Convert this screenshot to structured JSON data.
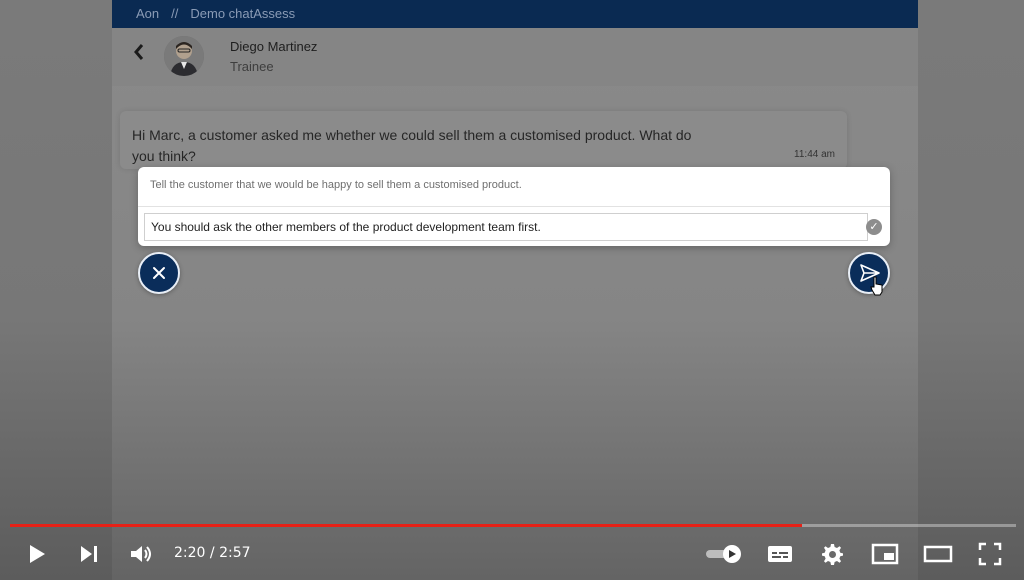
{
  "app": {
    "breadcrumb": {
      "org": "Aon",
      "separator": "//",
      "page": "Demo chatAssess"
    },
    "colors": {
      "brand": "#0a2a52",
      "accent": "#0a2d5a"
    }
  },
  "header": {
    "name": "Diego Martinez",
    "role": "Trainee"
  },
  "chat": {
    "message": "Hi Marc, a customer asked me whether we could sell them a customised product. What do you think?",
    "time": "11:44 am"
  },
  "responses": {
    "option_1": "Tell the customer that we would be happy to sell them a customised product.",
    "option_2": "You should ask the other members of the product development team first."
  },
  "player": {
    "current_time": "2:20",
    "duration": "2:57",
    "time_separator": "/",
    "progress": 0.787,
    "progress_color": "#e62117"
  },
  "icons": {
    "back": "chevron-left-icon",
    "cancel": "close-icon",
    "send": "send-icon"
  }
}
